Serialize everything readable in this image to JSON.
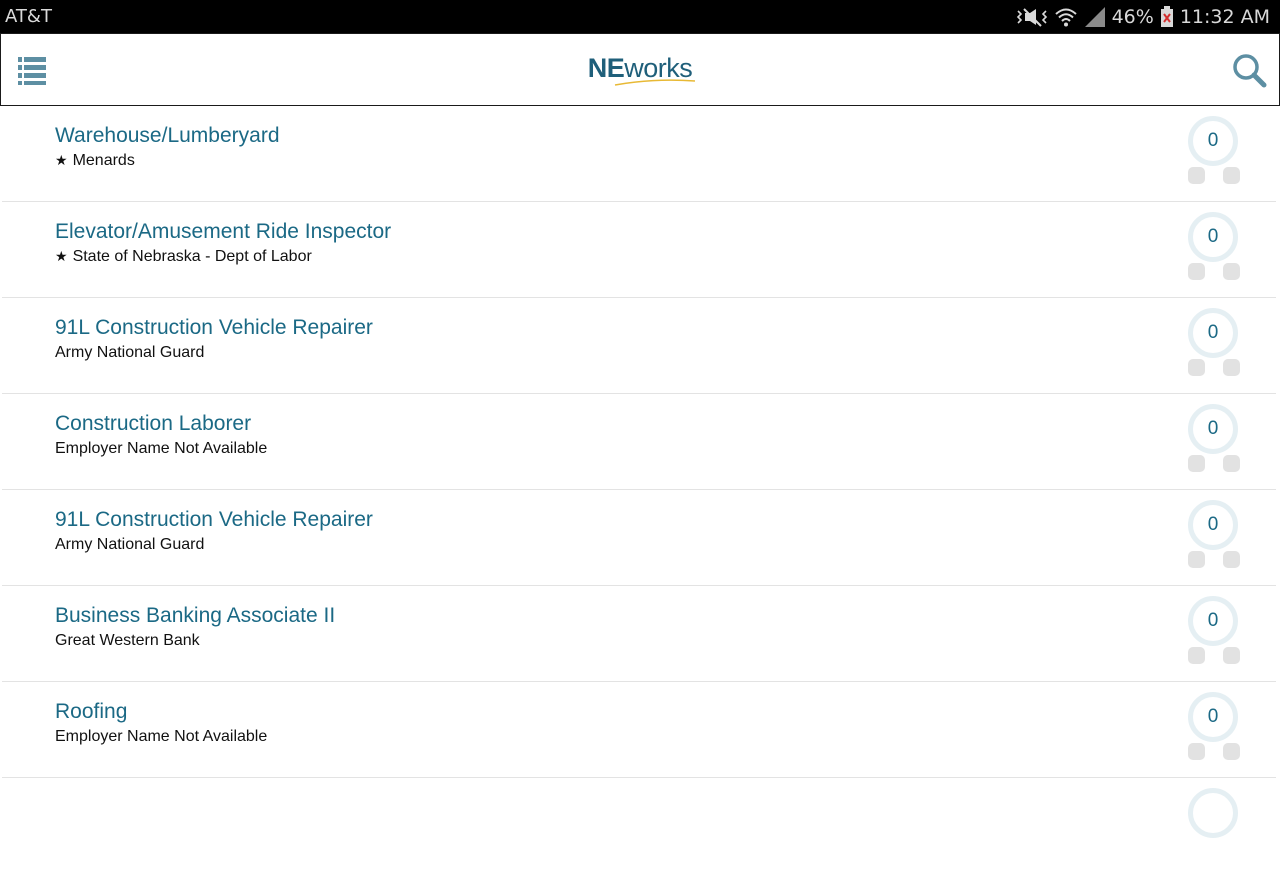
{
  "status_bar": {
    "carrier": "AT&T",
    "battery": "46%",
    "time": "11:32 AM",
    "icons": [
      "mute-vibrate-icon",
      "wifi-icon",
      "signal-icon",
      "battery-icon"
    ]
  },
  "header": {
    "logo_prefix": "NE",
    "logo_suffix": "works",
    "brand_color": "#1f5f7a",
    "accent_color": "#e8b935"
  },
  "jobs": [
    {
      "title": "Warehouse/Lumberyard",
      "employer": "Menards",
      "starred": true,
      "score": "0"
    },
    {
      "title": "Elevator/Amusement Ride Inspector",
      "employer": "State of Nebraska - Dept of Labor",
      "starred": true,
      "score": "0"
    },
    {
      "title": "91L Construction Vehicle Repairer",
      "employer": "Army National Guard",
      "starred": false,
      "score": "0"
    },
    {
      "title": "Construction Laborer",
      "employer": "Employer Name Not Available",
      "starred": false,
      "score": "0"
    },
    {
      "title": "91L Construction Vehicle Repairer",
      "employer": "Army National Guard",
      "starred": false,
      "score": "0"
    },
    {
      "title": "Business Banking Associate II",
      "employer": "Great Western Bank",
      "starred": false,
      "score": "0"
    },
    {
      "title": "Roofing",
      "employer": "Employer Name Not Available",
      "starred": false,
      "score": "0"
    }
  ],
  "star_glyph": "★"
}
